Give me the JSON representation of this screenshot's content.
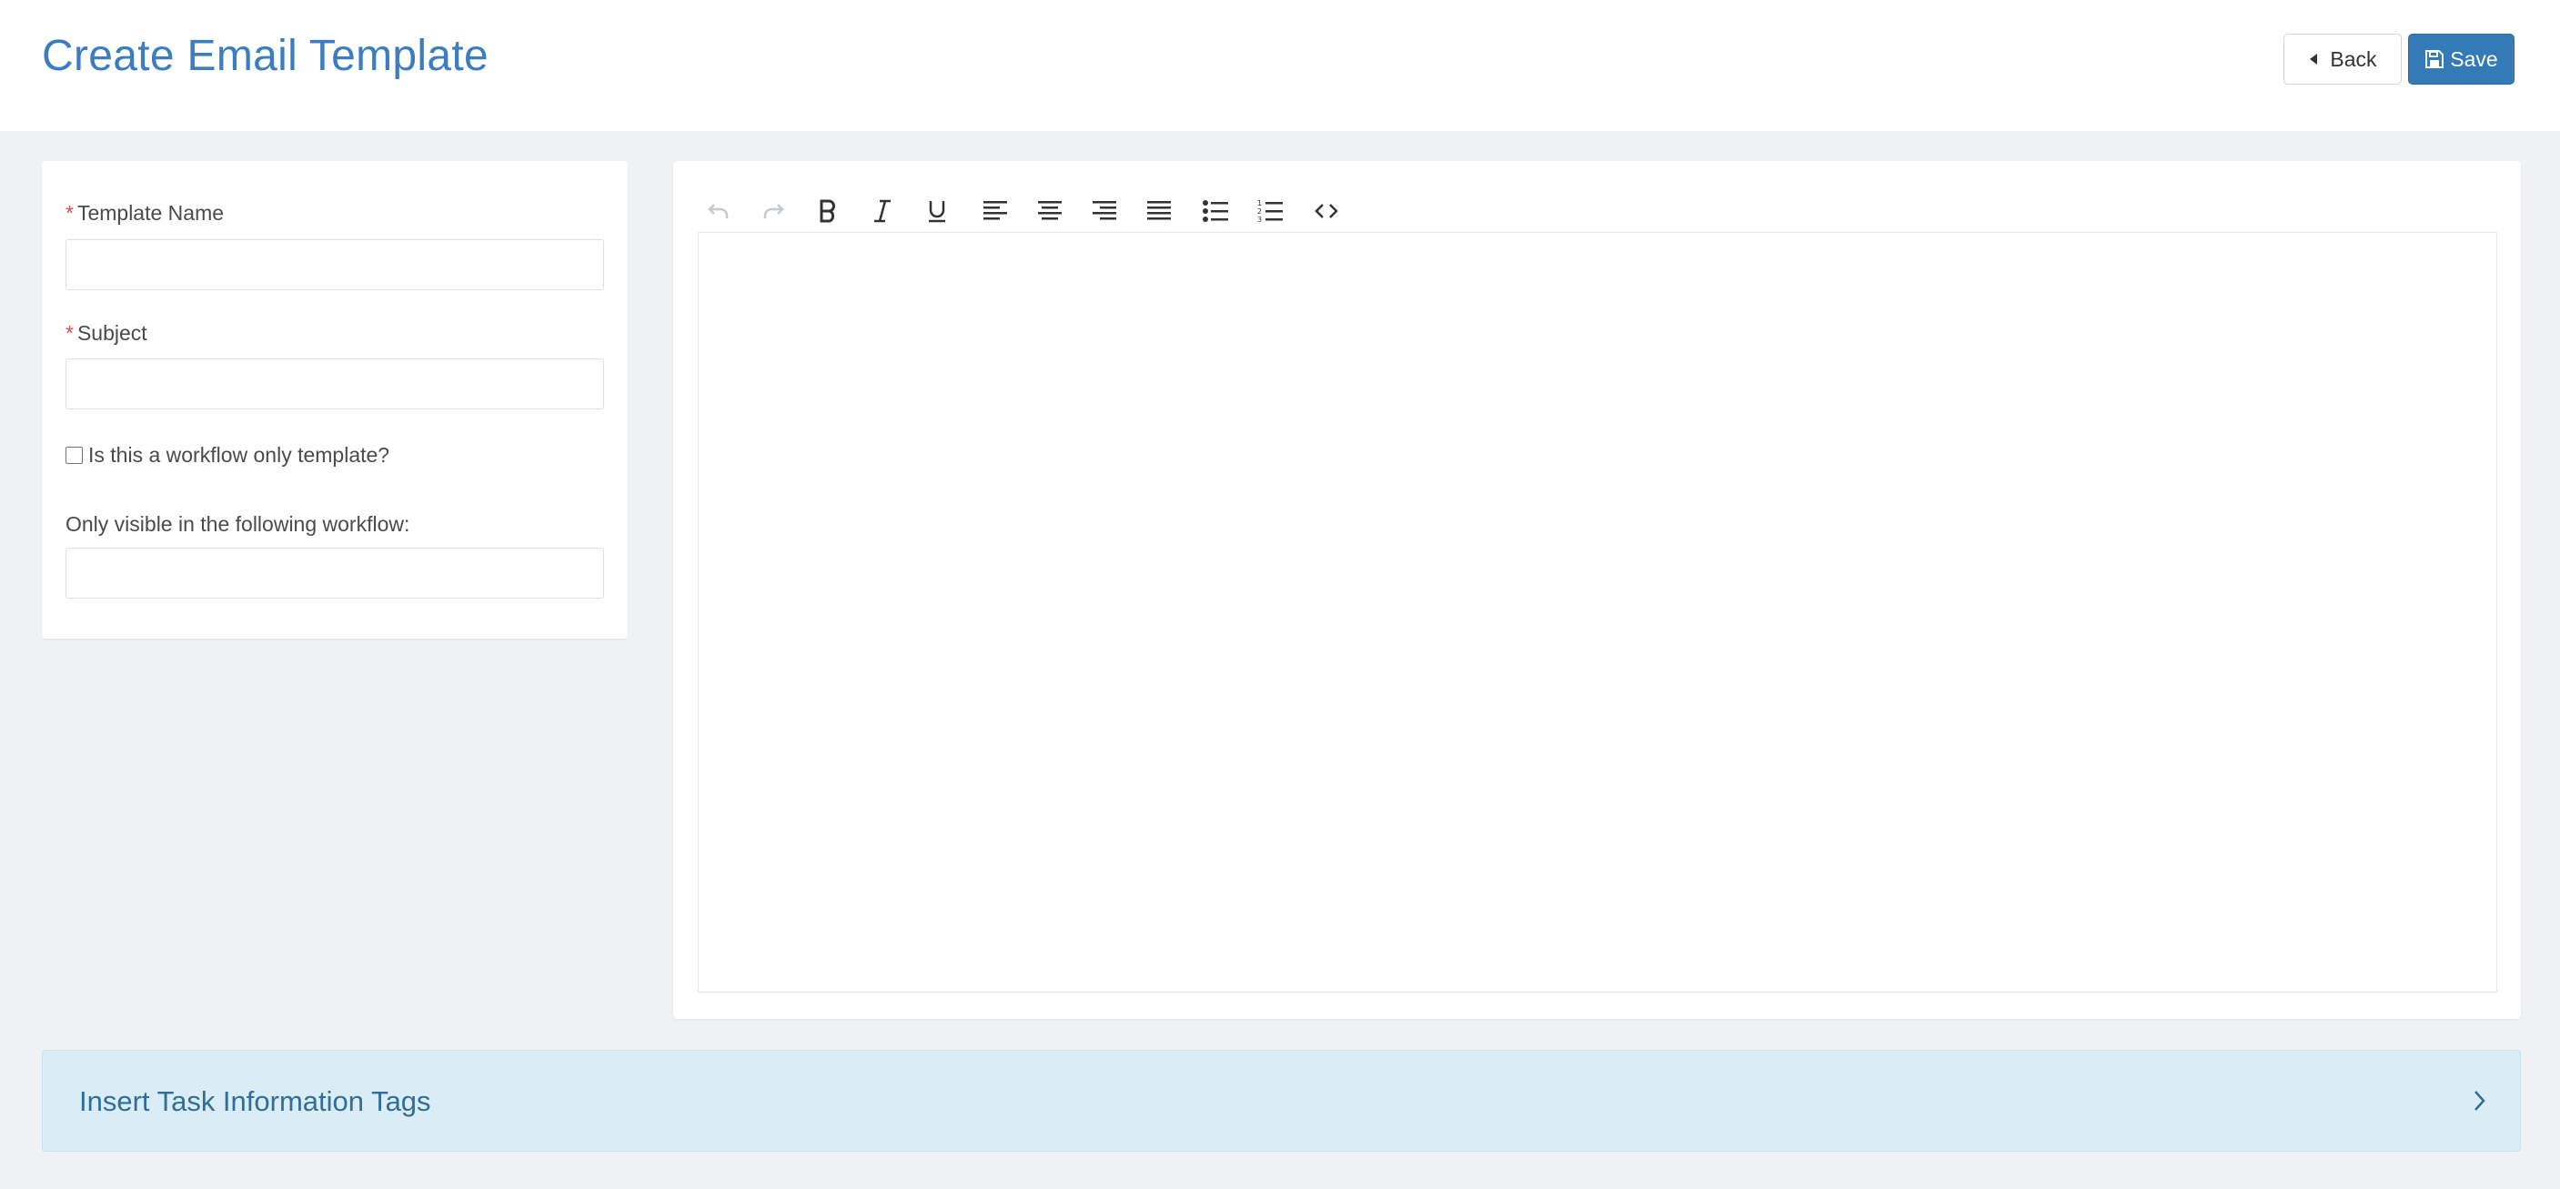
{
  "header": {
    "title": "Create Email Template",
    "back_label": "Back",
    "save_label": "Save"
  },
  "form": {
    "template_name_label": "Template Name",
    "template_name_value": "",
    "subject_label": "Subject",
    "subject_value": "",
    "required_marker": "*",
    "workflow_only_label": "Is this a workflow only template?",
    "workflow_only_checked": false,
    "visible_workflow_label": "Only visible in the following workflow:",
    "visible_workflow_value": ""
  },
  "editor": {
    "toolbar": [
      "undo-icon",
      "redo-icon",
      "bold-icon",
      "italic-icon",
      "underline-icon",
      "align-left-icon",
      "align-center-icon",
      "align-right-icon",
      "align-justify-icon",
      "bullet-list-icon",
      "numbered-list-icon",
      "code-view-icon"
    ],
    "content": ""
  },
  "accordion": {
    "title": "Insert Task Information Tags"
  },
  "colors": {
    "accent": "#337ab7",
    "title": "#3b7dbf",
    "required": "#e04b4b",
    "accordion_bg": "#daedf6"
  }
}
